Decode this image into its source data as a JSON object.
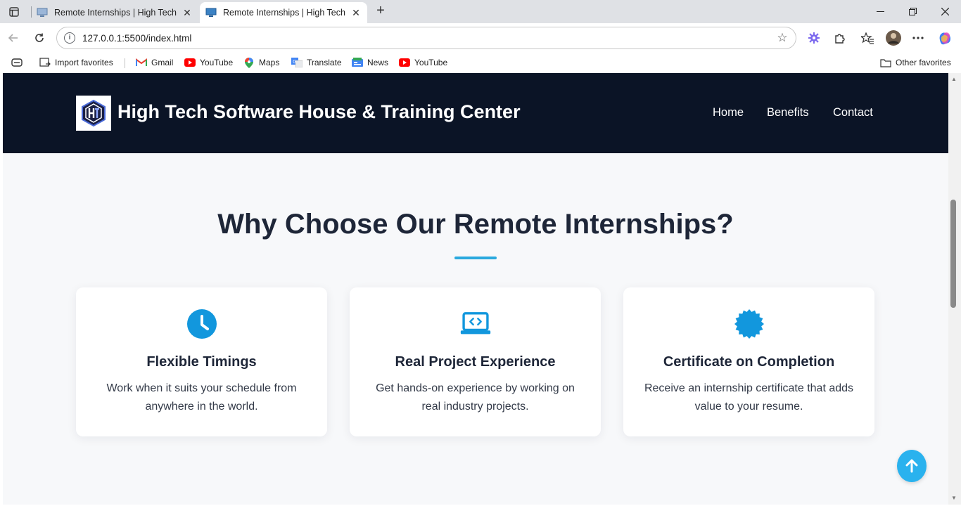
{
  "browser": {
    "tabs": [
      {
        "title": "Remote Internships | High Tech Sc",
        "active": false
      },
      {
        "title": "Remote Internships | High Tech Sc",
        "active": true
      }
    ],
    "url": "127.0.0.1:5500/index.html",
    "favorites": [
      {
        "label": "Import favorites",
        "icon": "import-icon"
      },
      {
        "label": "Gmail",
        "icon": "gmail-icon"
      },
      {
        "label": "YouTube",
        "icon": "youtube-icon"
      },
      {
        "label": "Maps",
        "icon": "maps-icon"
      },
      {
        "label": "Translate",
        "icon": "translate-icon"
      },
      {
        "label": "News",
        "icon": "news-icon"
      },
      {
        "label": "YouTube",
        "icon": "youtube-icon"
      }
    ],
    "other_favorites": "Other favorites"
  },
  "header": {
    "brand": "High Tech Software House & Training Center",
    "nav": [
      "Home",
      "Benefits",
      "Contact"
    ]
  },
  "benefits": {
    "title": "Why Choose Our Remote Internships?",
    "cards": [
      {
        "icon": "clock-icon",
        "title": "Flexible Timings",
        "desc": "Work when it suits your schedule from anywhere in the world."
      },
      {
        "icon": "laptop-code-icon",
        "title": "Real Project Experience",
        "desc": "Get hands-on experience by working on real industry projects."
      },
      {
        "icon": "certificate-icon",
        "title": "Certificate on Completion",
        "desc": "Receive an internship certificate that adds value to your resume."
      }
    ]
  },
  "colors": {
    "header_bg": "#0b1426",
    "accent": "#2aa9de",
    "icon": "#1297dd",
    "page_bg": "#f7f8fa"
  }
}
